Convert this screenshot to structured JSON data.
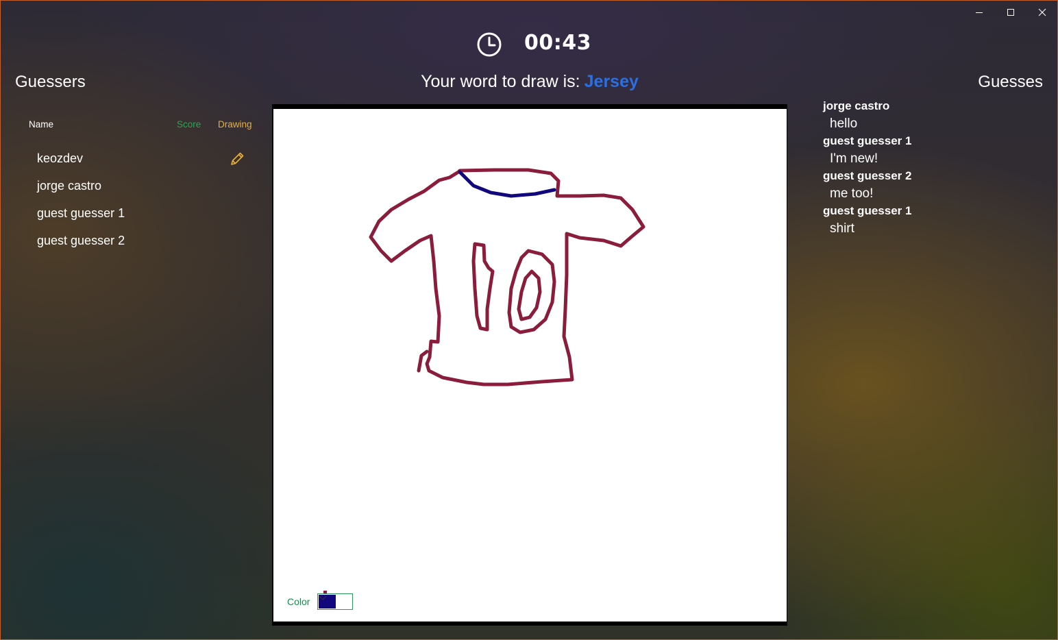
{
  "window": {
    "minimize_icon": "minimize-icon",
    "maximize_icon": "maximize-icon",
    "close_icon": "close-icon"
  },
  "timer": {
    "icon": "clock-icon",
    "remaining": "00:43"
  },
  "guessers_panel": {
    "title": "Guessers",
    "columns": {
      "name": "Name",
      "score": "Score",
      "drawing": "Drawing"
    },
    "players": [
      {
        "name": "keozdev",
        "is_drawing": true
      },
      {
        "name": "jorge castro",
        "is_drawing": false
      },
      {
        "name": "guest guesser 1",
        "is_drawing": false
      },
      {
        "name": "guest guesser 2",
        "is_drawing": false
      }
    ],
    "drawing_icon": "pencil-icon"
  },
  "prompt": {
    "label": "Your word to draw is:",
    "word": "Jersey"
  },
  "canvas": {
    "color_label": "Color",
    "selected_color": "#12087e",
    "stroke_colors": [
      "#8a1d3c",
      "#12087e"
    ]
  },
  "guesses_panel": {
    "title": "Guesses",
    "messages": [
      {
        "author": "jorge castro",
        "text": "hello"
      },
      {
        "author": "guest guesser 1",
        "text": "I'm new!"
      },
      {
        "author": "guest guesser 2",
        "text": "me too!"
      },
      {
        "author": "guest guesser 1",
        "text": "shirt"
      }
    ]
  },
  "colors": {
    "word_accent": "#2b6fe0",
    "score_header": "#25a84f",
    "drawing_header": "#e8b23a",
    "window_border": "#c2622a"
  }
}
